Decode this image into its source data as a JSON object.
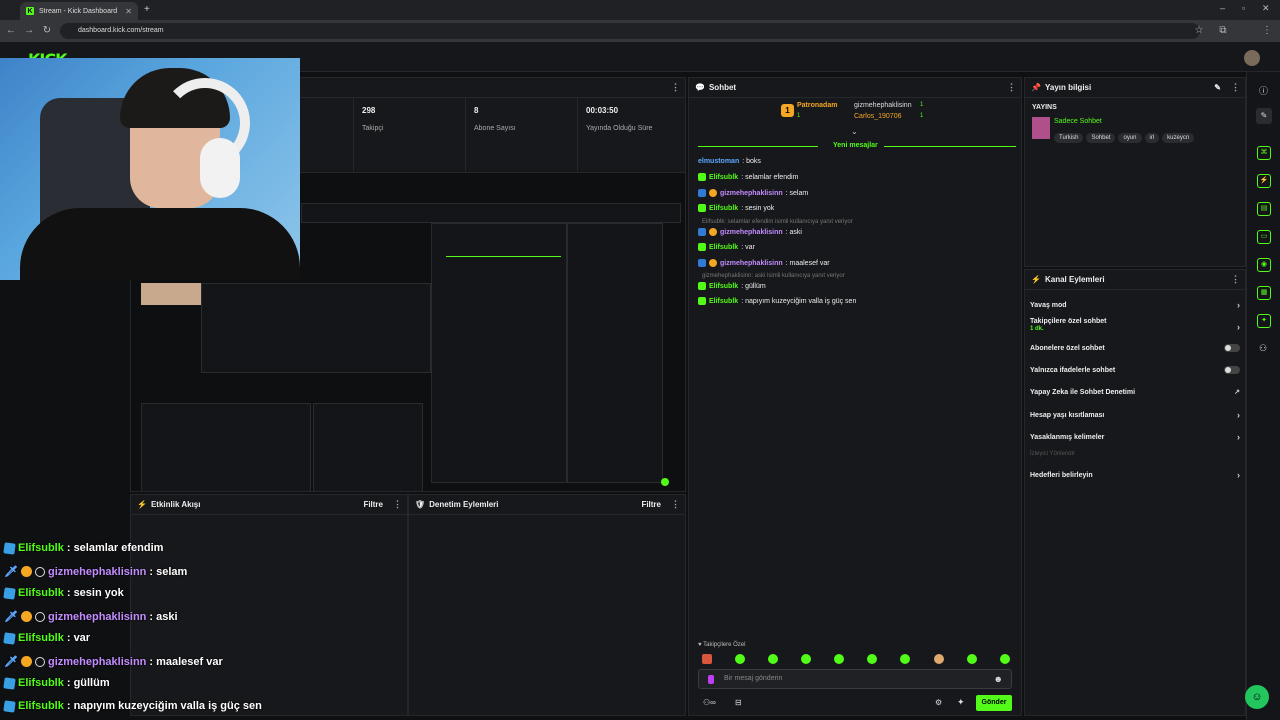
{
  "browser": {
    "tab_title": "Stream - Kick Dashboard",
    "tab_icon": "K",
    "url": "dashboard.kick.com/stream"
  },
  "logo": "KICK",
  "stats": [
    {
      "value": "298",
      "label": "Takipçi"
    },
    {
      "value": "8",
      "label": "Abone Sayısı"
    },
    {
      "value": "00:03:50",
      "label": "Yayında Olduğu Süre"
    }
  ],
  "chat": {
    "title": "Sohbet",
    "leaderboard": [
      {
        "rank": "1",
        "name": "Patronadam",
        "count": "1"
      },
      {
        "name": "gizmehephaklisinn",
        "count": "1"
      },
      {
        "name": "Carlos_190706",
        "count": "1"
      }
    ],
    "new_messages": "Yeni mesajlar",
    "messages": [
      {
        "user": "elmustoman",
        "text": ": boks"
      },
      {
        "user": "Elifsublk",
        "text": ": selamlar efendim"
      },
      {
        "user": "gizmehephaklisinn",
        "text": ": selam"
      },
      {
        "user": "Elifsublk",
        "text": ": sesin yok"
      },
      {
        "reply": "Elifsublk: selamlar efendim isimli kullanıcıya yanıt veriyor"
      },
      {
        "user": "gizmehephaklisinn",
        "text": ": aski"
      },
      {
        "user": "Elifsublk",
        "text": ": var"
      },
      {
        "user": "gizmehephaklisinn",
        "text": ": maalesef var"
      },
      {
        "reply": "gizmehephaklisinn: aski isimli kullanıcıya yanıt veriyor"
      },
      {
        "user": "Elifsublk",
        "text": ": güllüm"
      },
      {
        "user": "Elifsublk",
        "text": ": napıyım kuzeyciğim valla iş güç sen"
      }
    ],
    "followers_only": "Takipçilere Özel",
    "input_placeholder": "Bir mesaj gönderin",
    "send_label": "Gönder"
  },
  "stream_info": {
    "title": "Yayın bilgisi",
    "section": "YAYINS",
    "category": "Sadece Sohbet",
    "tags": [
      "Turkish",
      "Sohbet",
      "oyun",
      "irl",
      "kuzeycn"
    ]
  },
  "channel_actions": {
    "title": "Kanal Eylemleri",
    "items": [
      {
        "label": "Yavaş mod",
        "control": "arrow"
      },
      {
        "label": "Takipçilere özel sohbet",
        "sub": "1 dk.",
        "control": "arrow"
      },
      {
        "label": "Abonelere özel sohbet",
        "control": "toggle"
      },
      {
        "label": "Yalnızca ifadelerle sohbet",
        "control": "toggle"
      },
      {
        "label": "Yapay Zeka ile Sohbet Denetimi",
        "control": "ext"
      },
      {
        "label": "Hesap yaşı kısıtlaması",
        "control": "arrow"
      },
      {
        "label": "Yasaklanmış kelimeler",
        "control": "arrow"
      },
      {
        "label": "İzleyici Yönlendir",
        "control": "none"
      },
      {
        "label": "Hedefleri belirleyin",
        "control": "arrow"
      }
    ]
  },
  "activity": {
    "title": "Etkinlik Akışı",
    "filter": "Filtre"
  },
  "moderation": {
    "title": "Denetim Eylemleri",
    "filter": "Filtre"
  },
  "overlay_chat": [
    {
      "user": "Elifsublk",
      "text": ": selamlar efendim",
      "kind": "sub"
    },
    {
      "user": "gizmehephaklisinn",
      "text": ": selam",
      "kind": "mod"
    },
    {
      "user": "Elifsublk",
      "text": ": sesin yok",
      "kind": "sub"
    },
    {
      "user": "gizmehephaklisinn",
      "text": ": aski",
      "kind": "mod"
    },
    {
      "user": "Elifsublk",
      "text": ": var",
      "kind": "sub"
    },
    {
      "user": "gizmehephaklisinn",
      "text": ": maalesef var",
      "kind": "mod"
    },
    {
      "user": "Elifsublk",
      "text": ": güllüm",
      "kind": "sub"
    },
    {
      "user": "Elifsublk",
      "text": ": napıyım kuzeyciğim valla iş güç sen",
      "kind": "sub"
    }
  ],
  "colors": {
    "accent": "#53fc18",
    "bg": "#0f1012",
    "panel": "#17181b",
    "mod_name": "#c38cff"
  }
}
